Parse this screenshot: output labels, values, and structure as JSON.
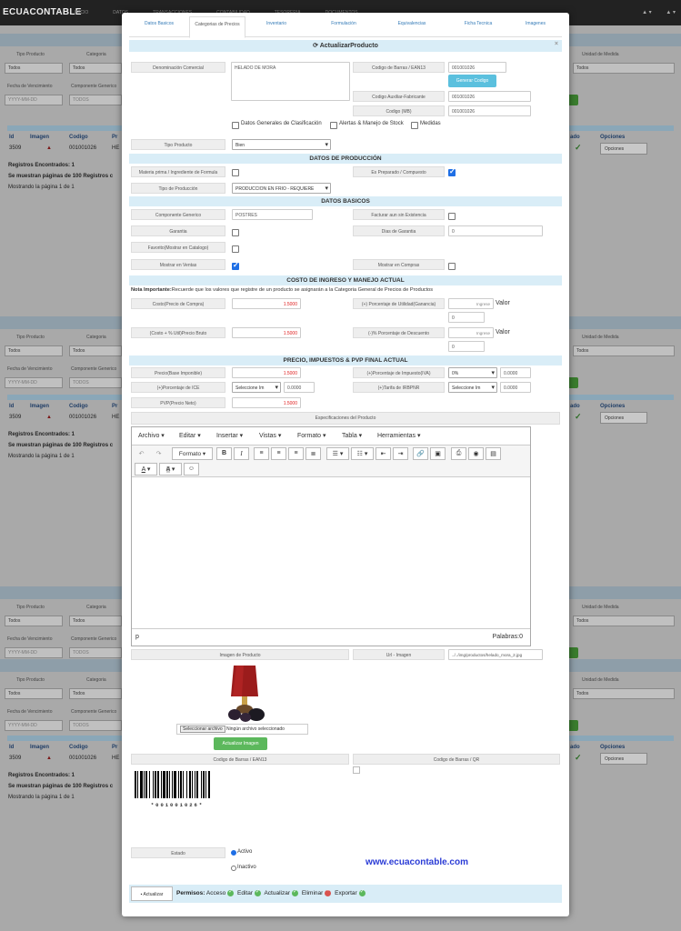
{
  "topbar": {
    "brand": "ECUACONTABLE",
    "nav": [
      "INICIO",
      "DATOS",
      "TRANSACCIONES",
      "CONTABILIDAD",
      "TESORERIA",
      "DOCUMENTOS"
    ],
    "right": [
      "▲ ▾",
      "▲ ▾"
    ]
  },
  "background": {
    "filter_labels": {
      "tipo_producto": "Tipo Producto",
      "categoria": "Categoria",
      "fecha_venc": "Fecha de Vencimiento",
      "componente": "Componente Generico",
      "unidad_medida": "Unidad de Medida"
    },
    "todos": "Todos",
    "todos_upper": "TODOS",
    "date_placeholder": "YYYY-MM-DD",
    "headers": {
      "id": "Id",
      "imagen": "Imagen",
      "codigo": "Codigo",
      "pr": "Pr",
      "estado": "ado",
      "opciones": "Opciones"
    },
    "row": {
      "id": "3509",
      "codigo": "001001026",
      "name": "HE",
      "opciones": "Opciones"
    },
    "registros": "Registros Encontrados: 1",
    "paginas": "Se muestran páginas de 100 Registros c",
    "mostrando": "Mostrando la página 1 de 1"
  },
  "tabs": [
    "Datos Basicos",
    "Categorias de Precios",
    "Inventario",
    "Formulación",
    "Equivalencias",
    "Ficha Tecnica",
    "Imagenes"
  ],
  "form": {
    "title": "ActualizarProducto",
    "close": "×",
    "denominacion_label": "Denominación Comercial",
    "denominacion_value": "HELADO DE MORA",
    "ean_label": "Codigo de Barras / EAN13",
    "ean_value": "001001026",
    "generar": "Generar Codigo",
    "auxiliar_label": "Codigo Auxiliar-Fabricante",
    "auxiliar_value": "001001026",
    "codigo_mb_label": "Codigo (MB)",
    "codigo_mb_value": "001001026",
    "chk_generales": "Datos Generales de Clasificación",
    "chk_alertas": "Alertas & Manejo de Stock",
    "chk_medidas": "Medidas",
    "tipo_producto_label": "Tipo Producto",
    "tipo_producto_value": "Bien",
    "sec_produccion": "DATOS DE PRODUCCIÓN",
    "materia_prima_label": "Materia prima / Ingrediente de Formula",
    "preparado_label": "Es Preparado / Compuesto",
    "tipo_produccion_label": "Tipo de Producción",
    "tipo_produccion_value": "PRODUCCION EN FRIO - REQUIERE",
    "sec_basicos": "DATOS BASICOS",
    "componente_label": "Componente Generico",
    "componente_value": "POSTRES",
    "facturar_label": "Facturar aun sin Existencia",
    "garantia_label": "Garantia",
    "dias_garantia_label": "Dias de Garantia",
    "dias_garantia_value": "0",
    "favorito_label": "Favorito(Mostrar en Catalogo)",
    "mostrar_ventas_label": "Mostrar en Ventas",
    "mostrar_compras_label": "Mostrar en Compras",
    "sec_costo": "COSTO DE INGRESO Y MANEJO ACTUAL",
    "nota_bold": "Nota Importante:",
    "nota_text": "Recuerde que los valores que registre de un producto se asignarán a la Categoria General de Precios de Productos",
    "costo_label": "Costo(Precio de Compra)",
    "costo_value": "1.5000",
    "pct_utilidad_label": "(+) Porcentaje de Utilidad(Ganancia)",
    "ingrese": "Ingrese",
    "valor": "Valor",
    "utilidad_value": "0",
    "costo_util_label": "(Costo + % Util)Precio Bruto",
    "costo_util_value": "1.5000",
    "pct_desc_label": "(-)% Porcentaje de Descuento",
    "desc_value": "0",
    "sec_precio": "PRECIO, IMPUESTOS & PVP FINAL ACTUAL",
    "precio_label": "Precio(Base Imponible)",
    "precio_value": "1.5000",
    "pct_iva_label": "(+)Porcentaje de Impuesto(IVA)",
    "iva_select": "0%",
    "iva_value": "0.0000",
    "ice_label": "(+)Porcentaje de ICE",
    "ice_select": "Seleccione Im",
    "ice_value": "0.0000",
    "irbpnr_label": "(+)Tarifa de IRBPNR",
    "irbpnr_select": "Seleccione Im",
    "irbpnr_value": "0.0000",
    "pvp_label": "PVP(Precio Neto)",
    "pvp_value": "1.5000",
    "especificaciones_label": "Especificaciones del Producto"
  },
  "editor": {
    "menus": [
      "Archivo",
      "Editar",
      "Insertar",
      "Vistas",
      "Formato",
      "Tabla",
      "Herramientas"
    ],
    "formato_btn": "Formato",
    "status_p": "p",
    "palabras": "Palabras:0"
  },
  "imagen": {
    "label": "Imagen de Producto",
    "url_label": "Url - Imagen",
    "url_value": "../../img/productos/helado_mora_2.jpg",
    "file_btn": "Seleccionar archivo",
    "file_none": "Ningún archivo seleccionado",
    "actualizar_imagen": "Actualizar Imagen",
    "barcode_label": "Codigo de Barras / EAN13",
    "qr_label": "Codigo de Barras / QR",
    "barcode_text": "*001001026*"
  },
  "estado": {
    "label": "Estado",
    "activo": "Activo",
    "inactivo": "Inactivo",
    "website": "www.ecuacontable.com"
  },
  "footer": {
    "actualizar": "Actualizar",
    "permisos": "Permisos:",
    "acceso": "Acceso",
    "editar": "Editar",
    "actualizar2": "Actualizar",
    "eliminar": "Eliminar",
    "exportar": "Exportar"
  }
}
